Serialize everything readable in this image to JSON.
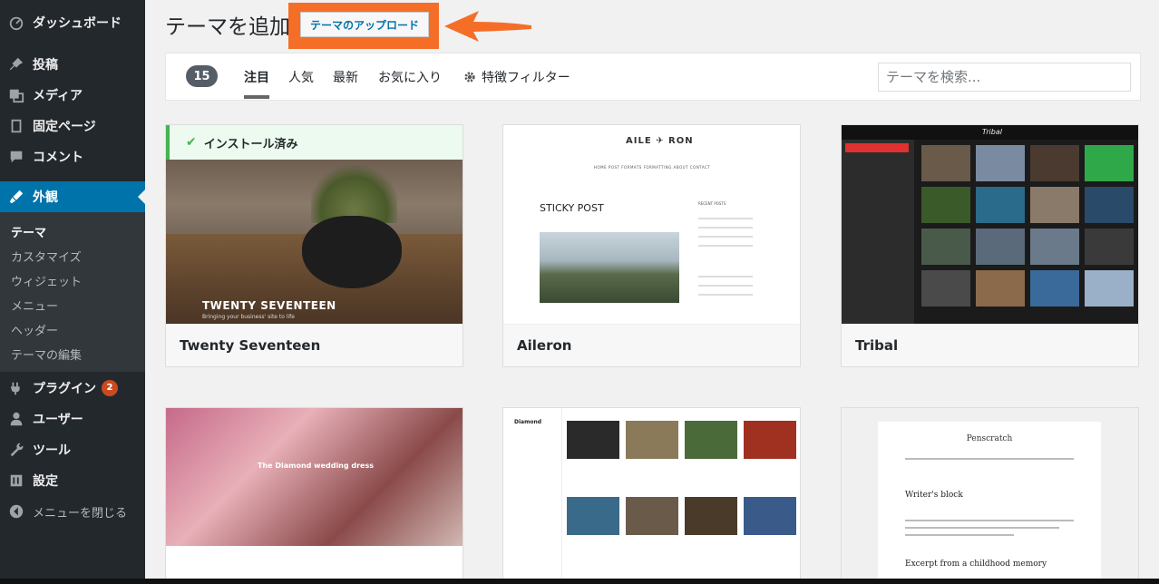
{
  "sidebar": {
    "items": [
      {
        "label": "ダッシュボード",
        "icon": "dashboard-icon"
      },
      {
        "label": "投稿",
        "icon": "pin-icon"
      },
      {
        "label": "メディア",
        "icon": "media-icon"
      },
      {
        "label": "固定ページ",
        "icon": "page-icon"
      },
      {
        "label": "コメント",
        "icon": "comment-icon"
      },
      {
        "label": "外観",
        "icon": "appearance-icon"
      },
      {
        "label": "プラグイン",
        "icon": "plugin-icon",
        "badge": "2"
      },
      {
        "label": "ユーザー",
        "icon": "user-icon"
      },
      {
        "label": "ツール",
        "icon": "tool-icon"
      },
      {
        "label": "設定",
        "icon": "settings-icon"
      },
      {
        "label": "メニューを閉じる",
        "icon": "collapse-icon"
      }
    ],
    "submenu": [
      "テーマ",
      "カスタマイズ",
      "ウィジェット",
      "メニュー",
      "ヘッダー",
      "テーマの編集"
    ]
  },
  "header": {
    "title": "テーマを追加",
    "upload_label": "テーマのアップロード"
  },
  "filter": {
    "count": "15",
    "tabs": [
      "注目",
      "人気",
      "最新",
      "お気に入り"
    ],
    "feature_filter": "特徴フィルター",
    "search_placeholder": "テーマを検索..."
  },
  "themes": {
    "installed_label": "インストール済み",
    "t1": {
      "name": "Twenty Seventeen",
      "shot_title": "TWENTY SEVENTEEN",
      "shot_sub": "Bringing your business' site to life"
    },
    "t2": {
      "name": "Aileron",
      "logo": "AILE ✈ RON",
      "nav": "HOME   POST FORMATS   FORMATTING   ABOUT   CONTACT",
      "sticky": "STICKY POST",
      "recent": "RECENT POSTS"
    },
    "t3": {
      "name": "Tribal",
      "logo": "Tribal"
    },
    "t4": {
      "shot_title": "The Diamond wedding dress"
    },
    "t5": {
      "shot_name": "Diamond"
    },
    "t6": {
      "title": "Penscratch",
      "h1": "Writer's block",
      "h2": "Excerpt from a childhood memory"
    }
  },
  "colors": {
    "sidebar_bg": "#23282d",
    "active_blue": "#0073aa",
    "highlight_orange": "#f56e28",
    "installed_green": "#46b450",
    "badge_red": "#ca4a1f"
  }
}
